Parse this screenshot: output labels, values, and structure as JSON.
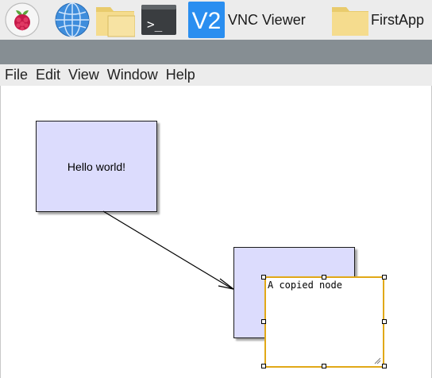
{
  "taskbar": {
    "launchers": [
      {
        "icon": "raspberry-pi-menu-icon"
      },
      {
        "icon": "web-browser-globe-icon"
      },
      {
        "icon": "file-manager-folder-icon"
      },
      {
        "icon": "terminal-icon",
        "glyph": ">_"
      }
    ],
    "tasks": [
      {
        "label": "VNC Viewer",
        "icon": "vnc-viewer-icon",
        "logo_text": "V2"
      },
      {
        "label": "FirstApp",
        "icon": "folder-icon"
      }
    ]
  },
  "menubar": {
    "items": [
      "File",
      "Edit",
      "View",
      "Window",
      "Help"
    ]
  },
  "canvas": {
    "nodes": [
      {
        "label": "Hello world!"
      },
      {
        "label": ""
      }
    ],
    "editor": {
      "value": "A copied node",
      "border_color": "#e1a817"
    }
  },
  "colors": {
    "node_fill": "#dcdcfd",
    "title_strip": "#868e93",
    "panel": "#ececec",
    "vnc_blue": "#2a8ef0",
    "folder_yellow": "#f5dc8e"
  }
}
